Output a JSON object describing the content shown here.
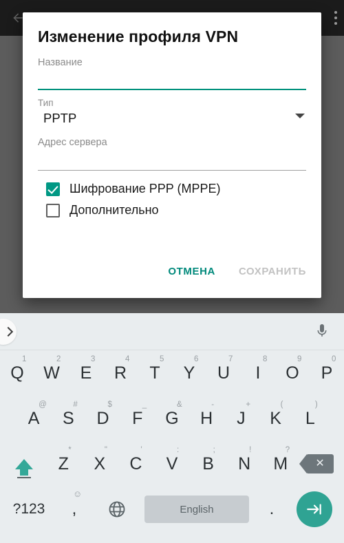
{
  "app_bar": {
    "back_icon": "back-arrow-icon",
    "overflow_icon": "overflow-menu-icon"
  },
  "dialog": {
    "title": "Изменение профиля VPN",
    "name_field": {
      "label": "Название",
      "value": "",
      "focused": true,
      "underline_color": "#00917c"
    },
    "type_field": {
      "label": "Тип",
      "value": "PPTP",
      "caret_icon": "chevron-down-icon",
      "options": [
        "PPTP"
      ]
    },
    "server_field": {
      "label": "Адрес сервера",
      "value": "",
      "underline_color": "#9e9e9e"
    },
    "checkboxes": [
      {
        "label": "Шифрование PPP (MPPE)",
        "checked": true
      },
      {
        "label": "Дополнительно",
        "checked": false
      }
    ],
    "buttons": {
      "cancel": "ОТМЕНА",
      "save": "СОХРАНИТЬ"
    },
    "colors": {
      "accent": "#00897b",
      "disabled": "#c2c2c2"
    }
  },
  "keyboard": {
    "suggestion_bar": {
      "expand_icon": "chevron-right-icon",
      "mic_icon": "microphone-icon"
    },
    "row1": [
      {
        "key": "Q",
        "sup": "1"
      },
      {
        "key": "W",
        "sup": "2"
      },
      {
        "key": "E",
        "sup": "3"
      },
      {
        "key": "R",
        "sup": "4"
      },
      {
        "key": "T",
        "sup": "5"
      },
      {
        "key": "Y",
        "sup": "6"
      },
      {
        "key": "U",
        "sup": "7"
      },
      {
        "key": "I",
        "sup": "8"
      },
      {
        "key": "O",
        "sup": "9"
      },
      {
        "key": "P",
        "sup": "0"
      }
    ],
    "row2": [
      {
        "key": "A",
        "sup": "@"
      },
      {
        "key": "S",
        "sup": "#"
      },
      {
        "key": "D",
        "sup": "$"
      },
      {
        "key": "F",
        "sup": "_"
      },
      {
        "key": "G",
        "sup": "&"
      },
      {
        "key": "H",
        "sup": "-"
      },
      {
        "key": "J",
        "sup": "+"
      },
      {
        "key": "K",
        "sup": "("
      },
      {
        "key": "L",
        "sup": ")"
      }
    ],
    "row3": {
      "shift_icon": "shift-caps-icon",
      "keys": [
        {
          "key": "Z",
          "sup": "*"
        },
        {
          "key": "X",
          "sup": "\""
        },
        {
          "key": "C",
          "sup": "'"
        },
        {
          "key": "V",
          "sup": ":"
        },
        {
          "key": "B",
          "sup": ";"
        },
        {
          "key": "N",
          "sup": "!"
        },
        {
          "key": "M",
          "sup": "?"
        }
      ],
      "backspace_icon": "backspace-icon"
    },
    "row4": {
      "symbols_key": "?123",
      "comma_key": ",",
      "emoji_sup": "☺",
      "globe_icon": "globe-language-icon",
      "space_label": "English",
      "period_key": ".",
      "enter_icon": "tab-next-icon"
    },
    "colors": {
      "background": "#e9edef",
      "space_key": "#c7ccd0",
      "accent": "#2fa393"
    }
  }
}
